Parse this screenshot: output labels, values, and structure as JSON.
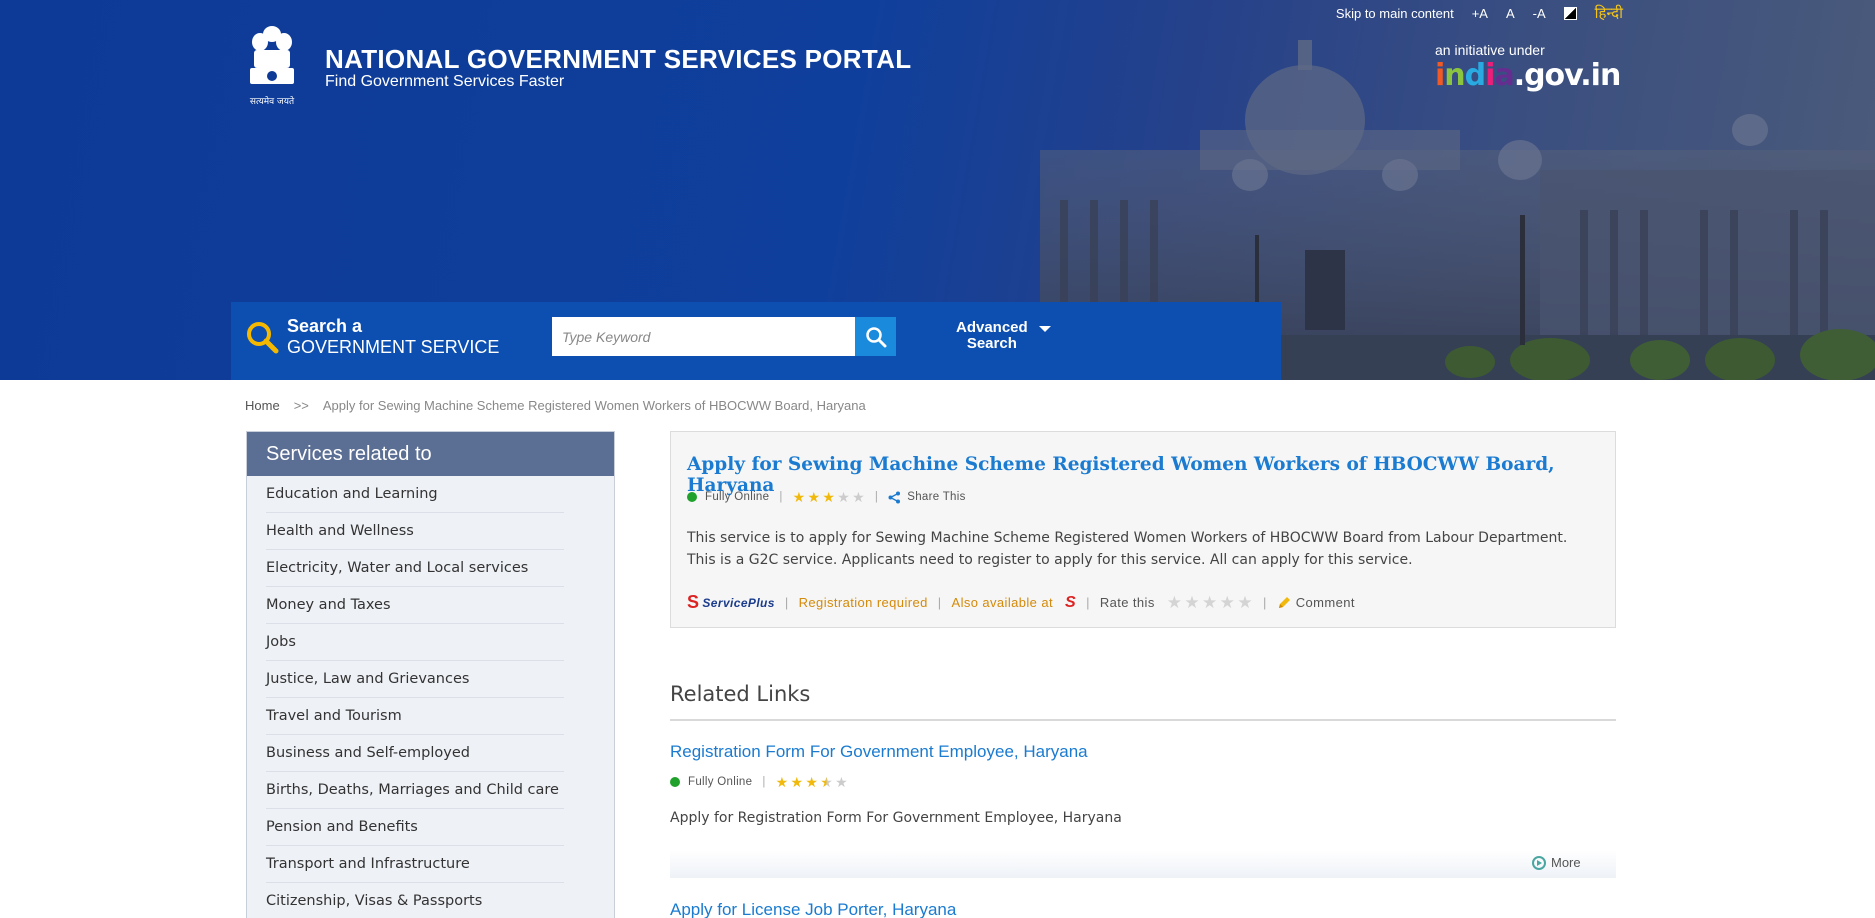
{
  "header": {
    "top_links": {
      "skip": "Skip to main content",
      "font_increase": "+A",
      "font_normal": "A",
      "font_decrease": "-A",
      "hindi": "हिन्दी"
    },
    "emblem_caption": "सत्यमेव जयते",
    "title": "NATIONAL GOVERNMENT SERVICES PORTAL",
    "subtitle": "Find Government Services Faster",
    "initiative_label": "an initiative under",
    "initiative_logo": "india.gov.in"
  },
  "search": {
    "label_line1": "Search a",
    "label_line2": "GOVERNMENT SERVICE",
    "placeholder": "Type Keyword",
    "advanced_line1": "Advanced",
    "advanced_line2": "Search"
  },
  "breadcrumb": {
    "home": "Home",
    "separator": ">>",
    "current": "Apply for Sewing Machine Scheme Registered Women Workers of HBOCWW Board, Haryana"
  },
  "sidebar": {
    "heading": "Services related to",
    "items": [
      "Education and Learning",
      "Health and Wellness",
      "Electricity, Water and Local services",
      "Money and Taxes",
      "Jobs",
      "Justice, Law and Grievances",
      "Travel and Tourism",
      "Business and Self-employed",
      "Births, Deaths, Marriages and Child care",
      "Pension and Benefits",
      "Transport and Infrastructure",
      "Citizenship, Visas & Passports"
    ]
  },
  "service": {
    "title": "Apply for Sewing Machine Scheme Registered Women Workers of HBOCWW Board, Haryana",
    "status": "Fully Online",
    "rating": 3,
    "share": "Share This",
    "description": "This service is to apply for Sewing Machine Scheme Registered Women Workers of HBOCWW Board from Labour Department. This is a G2C service. Applicants need to register to apply for this service. All can apply for this service.",
    "provider": "ServicePlus",
    "registration": "Registration required",
    "also_available": "Also available at",
    "rate_this": "Rate this",
    "comment": "Comment"
  },
  "related": {
    "heading": "Related Links",
    "items": [
      {
        "title": "Registration Form For Government Employee, Haryana",
        "status": "Fully Online",
        "rating": 3.5,
        "description": "Apply for Registration Form For Government Employee, Haryana",
        "more": "More"
      },
      {
        "title": "Apply for License Job Porter, Haryana"
      }
    ]
  },
  "colors": {
    "header_blue": "#0d3a96",
    "search_band": "#0d4fb0",
    "link_blue": "#1a7bd0",
    "sidebar_header": "#5b6e93",
    "online_green": "#1fa12b",
    "star_gold": "#f0b90b"
  }
}
